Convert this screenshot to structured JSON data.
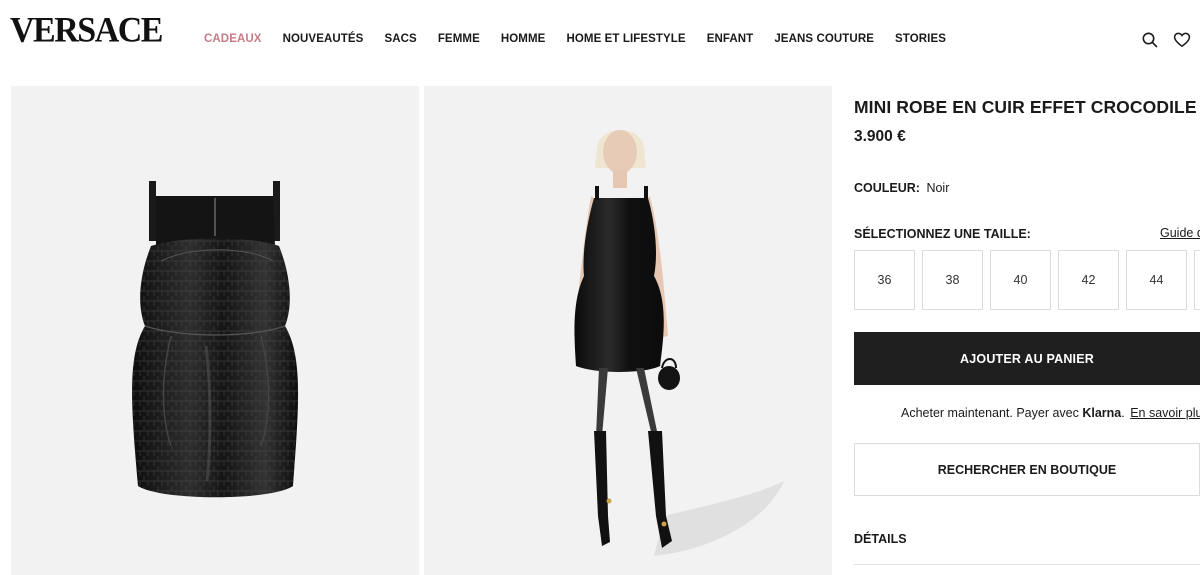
{
  "brand": {
    "logo_text": "VERSACE"
  },
  "nav": {
    "items": [
      {
        "label": "CADEAUX",
        "active": true
      },
      {
        "label": "NOUVEAUTÉS"
      },
      {
        "label": "SACS"
      },
      {
        "label": "FEMME"
      },
      {
        "label": "HOMME"
      },
      {
        "label": "HOME ET LIFESTYLE"
      },
      {
        "label": "ENFANT"
      },
      {
        "label": "JEANS COUTURE"
      },
      {
        "label": "STORIES"
      }
    ],
    "icons": [
      "search-icon",
      "heart-icon"
    ]
  },
  "product": {
    "title": "MINI ROBE EN CUIR EFFET CROCODILE",
    "price": "3.900 €",
    "color_label": "COULEUR:",
    "color_value": "Noir",
    "size_label": "SÉLECTIONNEZ UNE TAILLE:",
    "size_guide": "Guide d",
    "sizes": [
      "36",
      "38",
      "40",
      "42",
      "44"
    ],
    "add_to_cart": "AJOUTER AU PANIER",
    "klarna_prefix": "Acheter maintenant. Payer avec",
    "klarna_brand": "Klarna",
    "klarna_more": "En savoir plu",
    "store_search": "RECHERCHER EN BOUTIQUE",
    "details": "DÉTAILS"
  },
  "gallery": {
    "images": [
      "dress-flat-image",
      "model-image"
    ],
    "background_color": "#f2f2f2",
    "accent_color": "#c77a85"
  }
}
